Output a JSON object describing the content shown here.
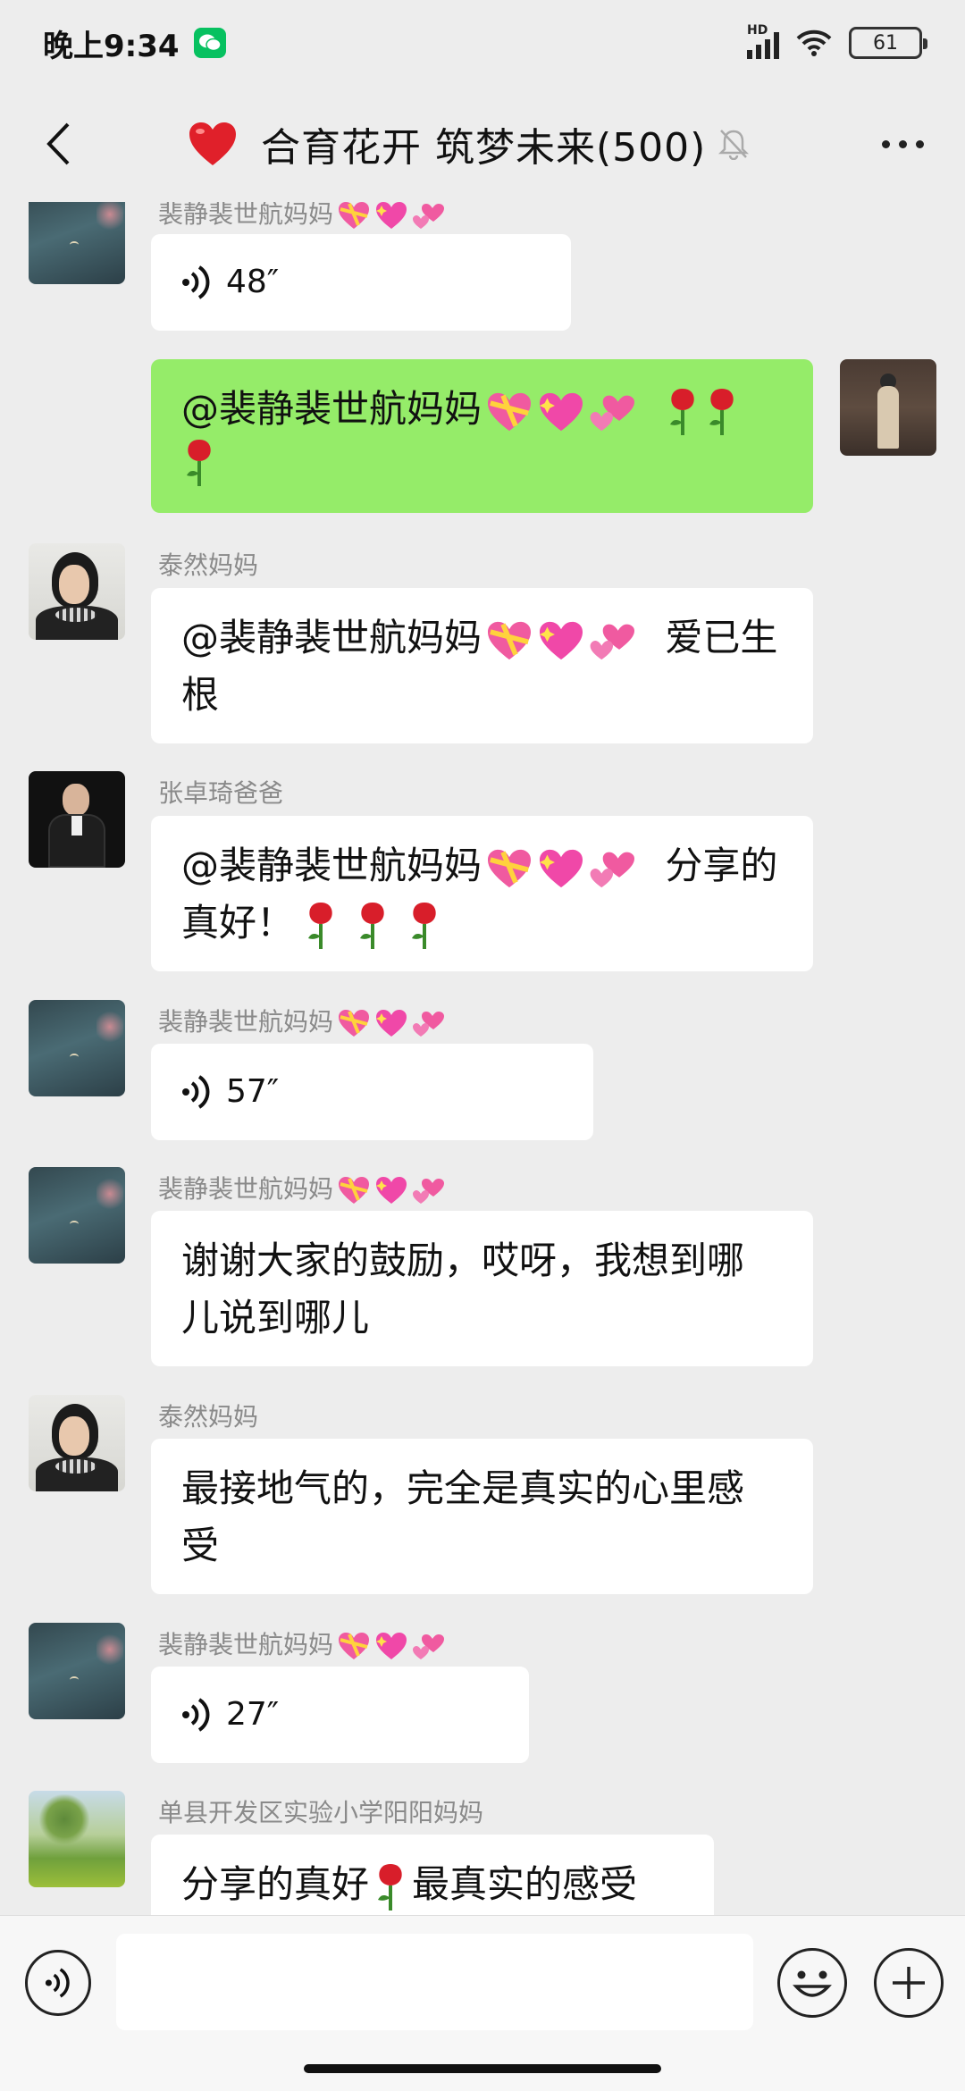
{
  "status_bar": {
    "time": "晚上9:34",
    "network": "HD",
    "battery": "61"
  },
  "header": {
    "title": "合育花开 筑梦未来(500)"
  },
  "messages": [
    {
      "sender": "裴静裴世航妈妈",
      "type": "voice",
      "duration": "48″"
    },
    {
      "sender": "",
      "type": "text",
      "text": "@裴静裴世航妈妈",
      "self": true
    },
    {
      "sender": "泰然妈妈",
      "type": "text",
      "text_a": "@裴静裴世航妈妈",
      "text_b": "爱已生",
      "text_c": "根"
    },
    {
      "sender": "张卓琦爸爸",
      "type": "text",
      "text_a": "@裴静裴世航妈妈",
      "text_b": "分享的",
      "text_c": "真好！"
    },
    {
      "sender": "裴静裴世航妈妈",
      "type": "voice",
      "duration": "57″"
    },
    {
      "sender": "裴静裴世航妈妈",
      "type": "text",
      "line1": "谢谢大家的鼓励，哎呀，我想到哪",
      "line2": "儿说到哪儿"
    },
    {
      "sender": "泰然妈妈",
      "type": "text",
      "line1": "最接地气的，完全是真实的心里感",
      "line2": "受"
    },
    {
      "sender": "裴静裴世航妈妈",
      "type": "voice",
      "duration": "27″"
    },
    {
      "sender": "单县开发区实验小学阳阳妈妈",
      "type": "text",
      "text_a": "分享的真好",
      "text_b": "最真实的感受"
    }
  ],
  "icons": {
    "heart": "heart-icon",
    "rose": "rose-icon",
    "sparkle_hearts": [
      "heart-ribbon-icon",
      "sparkling-heart-icon",
      "revolving-hearts-icon"
    ]
  },
  "colors": {
    "self_bubble": "#95ec69",
    "other_bubble": "#ffffff",
    "background": "#ededed",
    "wechat_green": "#07c160"
  }
}
